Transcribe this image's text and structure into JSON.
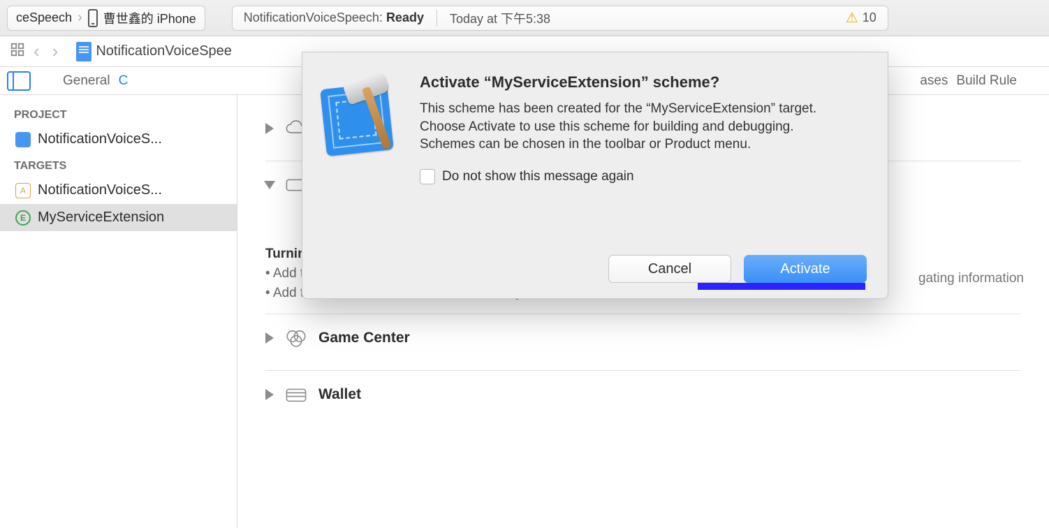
{
  "toolbar": {
    "scheme_left": "ceSpeech",
    "device": "曹世鑫的 iPhone",
    "status_project": "NotificationVoiceSpeech:",
    "status_state": "Ready",
    "status_time": "Today at 下午5:38",
    "warning_count": "10"
  },
  "navbar": {
    "crumb": "NotificationVoiceSpee"
  },
  "tabs": {
    "general": "General",
    "c_partial": "C",
    "phases_partial": "ases",
    "build_rules": "Build Rule"
  },
  "sidebar": {
    "project_hdr": "PROJECT",
    "project_item": "NotificationVoiceS...",
    "targets_hdr": "TARGETS",
    "target_app": "NotificationVoiceS...",
    "target_ext": "MyServiceExtension"
  },
  "content": {
    "cap_icloud": "",
    "cap_row2": "",
    "right_hint": "gating information",
    "push_heading": "Turning on Push Notifications will…",
    "push_line1": "• Add the Push Notifications feature to your App ID.",
    "push_line2": "• Add the Push Notifications entitlement to your entitlements file",
    "cap_gamecenter": "Game Center",
    "cap_wallet": "Wallet"
  },
  "dialog": {
    "title": "Activate “MyServiceExtension” scheme?",
    "body": "This scheme has been created for the “MyServiceExtension” target. Choose Activate to use this scheme for building and debugging. Schemes can be chosen in the toolbar or Product menu.",
    "checkbox": "Do not show this message again",
    "cancel": "Cancel",
    "activate": "Activate"
  }
}
